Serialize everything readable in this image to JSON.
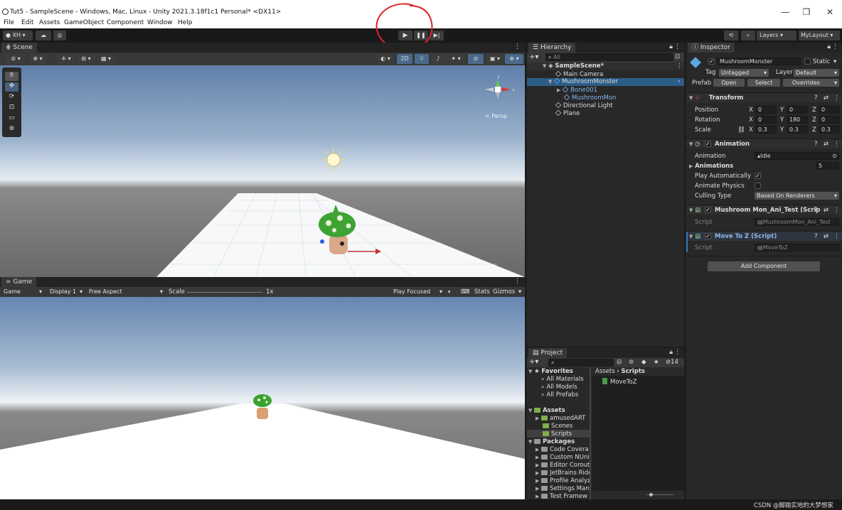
{
  "window": {
    "title": "Tut5 - SampleScene - Windows, Mac, Linux - Unity 2021.3.18f1c1 Personal* <DX11>",
    "min": "—",
    "max": "❐",
    "close": "✕"
  },
  "menu": [
    "File",
    "Edit",
    "Assets",
    "GameObject",
    "Component",
    "Window",
    "Help"
  ],
  "toolbar": {
    "account": "XH",
    "layers": "Layers",
    "layout": "MyLayout"
  },
  "scene": {
    "tab": "Scene",
    "persp": "< Persp",
    "btn2d": "2D"
  },
  "game": {
    "tab": "Game",
    "mode": "Game",
    "display": "Display 1",
    "aspect": "Free Aspect",
    "scale_label": "Scale",
    "scale_value": "1x",
    "play_focused": "Play Focused",
    "stats": "Stats",
    "gizmos": "Gizmos"
  },
  "hierarchy": {
    "tab": "Hierarchy",
    "search": "All",
    "items": [
      "SampleScene*",
      "Main Camera",
      "MushroomMonster",
      "Bone001",
      "MushroomMon",
      "Directional Light",
      "Plane"
    ]
  },
  "project": {
    "tab": "Project",
    "count": "14",
    "favorites": "Favorites",
    "fav_items": [
      "All Materials",
      "All Models",
      "All Prefabs"
    ],
    "assets": "Assets",
    "asset_items": [
      "amusedART",
      "Scenes",
      "Scripts"
    ],
    "packages": "Packages",
    "package_items": [
      "Code Covera",
      "Custom NUni",
      "Editor Corouti",
      "JetBrains Ride",
      "Profile Analyz",
      "Settings Man",
      "Test Framew"
    ],
    "breadcrumb_root": "Assets",
    "breadcrumb_leaf": "Scripts",
    "file": "MoveToZ"
  },
  "inspector": {
    "tab": "Inspector",
    "name": "MushroomMonster",
    "static": "Static",
    "tag_label": "Tag",
    "tag": "Untagged",
    "layer_label": "Layer",
    "layer": "Default",
    "prefab_label": "Prefab",
    "open": "Open",
    "select": "Select",
    "overrides": "Overrides",
    "transform": {
      "title": "Transform",
      "position": "Position",
      "rotation": "Rotation",
      "scale": "Scale",
      "pos": [
        "0",
        "0",
        "0"
      ],
      "rot": [
        "0",
        "180",
        "0"
      ],
      "scl": [
        "0.3",
        "0.3",
        "0.3"
      ]
    },
    "animation": {
      "title": "Animation",
      "anim_label": "Animation",
      "anim_value": "Idle",
      "anims_label": "Animations",
      "anims_count": "5",
      "play_auto": "Play Automatically",
      "animate_physics": "Animate Physics",
      "culling_label": "Culling Type",
      "culling_value": "Based On Renderers"
    },
    "script1": {
      "title": "Mushroom Mon_Ani_Test (Scrip",
      "label": "Script",
      "value": "MushroomMon_Ani_Test"
    },
    "script2": {
      "title": "Move To Z (Script)",
      "label": "Script",
      "value": "MoveToZ"
    },
    "add_component": "Add Component"
  },
  "watermark": "CSDN @脚踏实地的大梦想家",
  "colors": {
    "accent": "#3a79bb",
    "annotation": "#d9252a"
  }
}
